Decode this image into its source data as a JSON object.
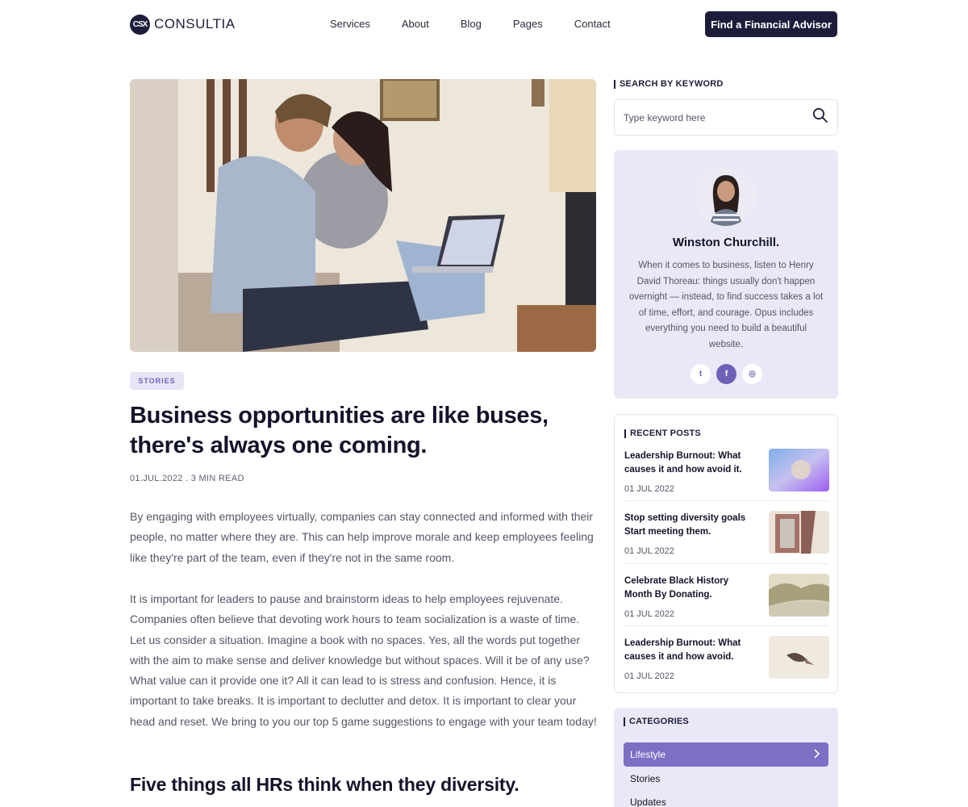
{
  "brand": {
    "name": "CONSULTIA",
    "mark": "CSX"
  },
  "nav": {
    "items": [
      "Services",
      "About",
      "Blog",
      "Pages",
      "Contact"
    ]
  },
  "cta": {
    "label": "Find a Financial Advisor"
  },
  "article": {
    "tag": "STORIES",
    "title": "Business opportunities are like buses, there's always one coming.",
    "meta": "01.JUL.2022 . 3 MIN READ",
    "paragraphs": [
      "By engaging with employees virtually, companies can stay connected and informed with their people, no matter where they are. This can help improve morale and keep employees feeling like they're part of the team, even if they're not in the same room.",
      "It is important for leaders to pause and brainstorm ideas to help employees rejuvenate. Companies often believe that devoting work hours to team socialization is a waste of time. Let us consider a situation. Imagine a book with no spaces. Yes, all the words put together with the aim to make sense and deliver knowledge but without spaces. Will it be of any use? What value can it provide one it? All it can lead to is stress and confusion. Hence, it is important to take breaks. It is important to declutter and detox. It is important to clear your head and reset. We bring to you our top 5 game suggestions to engage with your team today!"
    ],
    "subheading": "Five things all HRs think when they diversity."
  },
  "search": {
    "label": "SEARCH BY KEYWORD",
    "placeholder": "Type keyword here"
  },
  "author": {
    "name": "Winston Churchill.",
    "bio": "When it comes to business, listen to Henry David Thoreau: things usually don't happen overnight — instead, to find success takes a lot of time, effort, and courage. Opus includes everything you need to build a beautiful website.",
    "socials": [
      {
        "icon": "twitter-icon",
        "glyph": "t"
      },
      {
        "icon": "facebook-icon",
        "glyph": "f"
      },
      {
        "icon": "instagram-icon",
        "glyph": "◎"
      }
    ]
  },
  "recent": {
    "label": "RECENT POSTS",
    "posts": [
      {
        "title": "Leadership Burnout: What causes it and how avoid it.",
        "date": "01 JUL 2022"
      },
      {
        "title": "Stop setting diversity goals Start meeting them.",
        "date": "01 JUL 2022"
      },
      {
        "title": "Celebrate Black History Month By Donating.",
        "date": "01 JUL 2022"
      },
      {
        "title": "Leadership Burnout: What causes it and how avoid.",
        "date": "01 JUL 2022"
      }
    ]
  },
  "categories": {
    "label": "CATEGORIES",
    "items": [
      "Lifestyle",
      "Stories",
      "Updates"
    ],
    "active": "Lifestyle"
  },
  "colors": {
    "navy": "#1d1d3b",
    "accent": "#7b70c4",
    "lavender": "#e9e8f6"
  }
}
